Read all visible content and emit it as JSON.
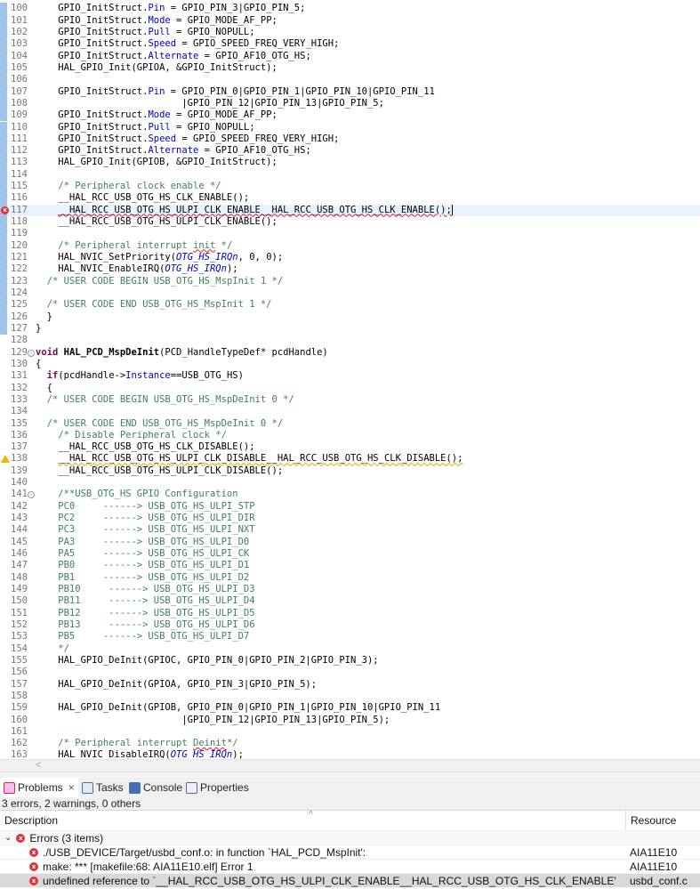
{
  "editor": {
    "lines": [
      {
        "n": "100",
        "chg": 1,
        "s": [
          [
            "t",
            "    GPIO_InitStruct."
          ],
          [
            "f",
            "Pin"
          ],
          [
            "t",
            " = GPIO_PIN_3|GPIO_PIN_5;"
          ]
        ]
      },
      {
        "n": "101",
        "chg": 1,
        "s": [
          [
            "t",
            "    GPIO_InitStruct."
          ],
          [
            "f",
            "Mode"
          ],
          [
            "t",
            " = GPIO_MODE_AF_PP;"
          ]
        ]
      },
      {
        "n": "102",
        "chg": 1,
        "s": [
          [
            "t",
            "    GPIO_InitStruct."
          ],
          [
            "f",
            "Pull"
          ],
          [
            "t",
            " = GPIO_NOPULL;"
          ]
        ]
      },
      {
        "n": "103",
        "chg": 1,
        "s": [
          [
            "t",
            "    GPIO_InitStruct."
          ],
          [
            "f",
            "Speed"
          ],
          [
            "t",
            " = GPIO_SPEED_FREQ_VERY_HIGH;"
          ]
        ]
      },
      {
        "n": "104",
        "chg": 1,
        "s": [
          [
            "t",
            "    GPIO_InitStruct."
          ],
          [
            "f",
            "Alternate"
          ],
          [
            "t",
            " = GPIO_AF10_OTG_HS;"
          ]
        ]
      },
      {
        "n": "105",
        "chg": 1,
        "s": [
          [
            "t",
            "    HAL_GPIO_Init(GPIOA, &GPIO_InitStruct);"
          ]
        ]
      },
      {
        "n": "106",
        "chg": 1,
        "s": []
      },
      {
        "n": "107",
        "chg": 1,
        "s": [
          [
            "t",
            "    GPIO_InitStruct."
          ],
          [
            "f",
            "Pin"
          ],
          [
            "t",
            " = GPIO_PIN_0|GPIO_PIN_1|GPIO_PIN_10|GPIO_PIN_11"
          ]
        ]
      },
      {
        "n": "108",
        "chg": 1,
        "s": [
          [
            "t",
            "                          |GPIO_PIN_12|GPIO_PIN_13|GPIO_PIN_5;"
          ]
        ]
      },
      {
        "n": "109",
        "chg": 1,
        "s": [
          [
            "t",
            "    GPIO_InitStruct."
          ],
          [
            "f",
            "Mode"
          ],
          [
            "t",
            " = GPIO_MODE_AF_PP;"
          ]
        ]
      },
      {
        "n": "110",
        "chg": 1,
        "s": [
          [
            "t",
            "    GPIO_InitStruct."
          ],
          [
            "f",
            "Pull"
          ],
          [
            "t",
            " = GPIO_NOPULL;"
          ]
        ]
      },
      {
        "n": "111",
        "chg": 1,
        "s": [
          [
            "t",
            "    GPIO_InitStruct."
          ],
          [
            "f",
            "Speed"
          ],
          [
            "t",
            " = GPIO_SPEED_FREQ_VERY_HIGH;"
          ]
        ]
      },
      {
        "n": "112",
        "chg": 1,
        "s": [
          [
            "t",
            "    GPIO_InitStruct."
          ],
          [
            "f",
            "Alternate"
          ],
          [
            "t",
            " = GPIO_AF10_OTG_HS;"
          ]
        ]
      },
      {
        "n": "113",
        "chg": 1,
        "s": [
          [
            "t",
            "    HAL_GPIO_Init(GPIOB, &GPIO_InitStruct);"
          ]
        ]
      },
      {
        "n": "114",
        "chg": 1,
        "s": []
      },
      {
        "n": "115",
        "chg": 1,
        "s": [
          [
            "c",
            "    /* Peripheral clock enable */"
          ]
        ]
      },
      {
        "n": "116",
        "chg": 1,
        "s": [
          [
            "t",
            "    __HAL_RCC_USB_OTG_HS_CLK_ENABLE();"
          ]
        ]
      },
      {
        "n": "117",
        "chg": 1,
        "mark": "error",
        "hl": 1,
        "s": [
          [
            "t",
            "    "
          ],
          [
            "err",
            "__HAL_RCC_USB_OTG_HS_ULPI_CLK_ENABLE__HAL_RCC_USB_OTG_HS_CLK_ENABLE();"
          ],
          [
            "caret",
            ""
          ]
        ]
      },
      {
        "n": "118",
        "chg": 1,
        "s": [
          [
            "t",
            "    __HAL_RCC_USB_OTG_HS_ULPI_CLK_ENABLE();"
          ]
        ]
      },
      {
        "n": "119",
        "chg": 1,
        "s": []
      },
      {
        "n": "120",
        "chg": 1,
        "s": [
          [
            "c",
            "    /* Peripheral interrupt "
          ],
          [
            "cs",
            "init"
          ],
          [
            "c",
            " */"
          ]
        ]
      },
      {
        "n": "121",
        "chg": 1,
        "s": [
          [
            "t",
            "    HAL_NVIC_SetPriority("
          ],
          [
            "i",
            "OTG_HS_IRQn"
          ],
          [
            "t",
            ", 0, 0);"
          ]
        ]
      },
      {
        "n": "122",
        "chg": 1,
        "s": [
          [
            "t",
            "    HAL_NVIC_EnableIRQ("
          ],
          [
            "i",
            "OTG_HS_IRQn"
          ],
          [
            "t",
            ");"
          ]
        ]
      },
      {
        "n": "123",
        "chg": 1,
        "s": [
          [
            "c",
            "  /* USER CODE BEGIN USB_OTG_HS_MspInit 1 */"
          ]
        ]
      },
      {
        "n": "124",
        "chg": 1,
        "s": []
      },
      {
        "n": "125",
        "chg": 1,
        "s": [
          [
            "c",
            "  /* USER CODE END USB_OTG_HS_MspInit 1 */"
          ]
        ]
      },
      {
        "n": "126",
        "chg": 1,
        "s": [
          [
            "t",
            "  }"
          ]
        ]
      },
      {
        "n": "127",
        "chg": 1,
        "s": [
          [
            "t",
            "}"
          ]
        ]
      },
      {
        "n": "128",
        "s": []
      },
      {
        "n": "129",
        "fold": 1,
        "s": [
          [
            "k",
            "void"
          ],
          [
            "t",
            " "
          ],
          [
            "b",
            "HAL_PCD_MspDeInit"
          ],
          [
            "t",
            "(PCD_HandleTypeDef* pcdHandle)"
          ]
        ]
      },
      {
        "n": "130",
        "s": [
          [
            "t",
            "{"
          ]
        ]
      },
      {
        "n": "131",
        "s": [
          [
            "t",
            "  "
          ],
          [
            "k",
            "if"
          ],
          [
            "t",
            "(pcdHandle->"
          ],
          [
            "f",
            "Instance"
          ],
          [
            "t",
            "==USB_OTG_HS)"
          ]
        ]
      },
      {
        "n": "132",
        "s": [
          [
            "t",
            "  {"
          ]
        ]
      },
      {
        "n": "133",
        "s": [
          [
            "c",
            "  /* USER CODE BEGIN USB_OTG_HS_MspDeInit 0 */"
          ]
        ]
      },
      {
        "n": "134",
        "s": []
      },
      {
        "n": "135",
        "s": [
          [
            "c",
            "  /* USER CODE END USB_OTG_HS_MspDeInit 0 */"
          ]
        ]
      },
      {
        "n": "136",
        "s": [
          [
            "c",
            "    /* Disable Peripheral clock */"
          ]
        ]
      },
      {
        "n": "137",
        "s": [
          [
            "t",
            "    __HAL_RCC_USB_OTG_HS_CLK_DISABLE();"
          ]
        ]
      },
      {
        "n": "138",
        "mark": "warning",
        "s": [
          [
            "t",
            "    "
          ],
          [
            "warn",
            "__HAL_RCC_USB_OTG_HS_ULPI_CLK_DISABLE__HAL_RCC_USB_OTG_HS_CLK_DISABLE();"
          ]
        ]
      },
      {
        "n": "139",
        "s": [
          [
            "t",
            "    __HAL_RCC_USB_OTG_HS_ULPI_CLK_DISABLE();"
          ]
        ]
      },
      {
        "n": "140",
        "s": []
      },
      {
        "n": "141",
        "fold": 1,
        "s": [
          [
            "c",
            "    /**USB_OTG_HS GPIO Configuration"
          ]
        ]
      },
      {
        "n": "142",
        "s": [
          [
            "c",
            "    PC0     ------> USB_OTG_HS_ULPI_STP"
          ]
        ]
      },
      {
        "n": "143",
        "s": [
          [
            "c",
            "    PC2     ------> USB_OTG_HS_ULPI_DIR"
          ]
        ]
      },
      {
        "n": "144",
        "s": [
          [
            "c",
            "    PC3     ------> USB_OTG_HS_ULPI_NXT"
          ]
        ]
      },
      {
        "n": "145",
        "s": [
          [
            "c",
            "    PA3     ------> USB_OTG_HS_ULPI_D0"
          ]
        ]
      },
      {
        "n": "146",
        "s": [
          [
            "c",
            "    PA5     ------> USB_OTG_HS_ULPI_CK"
          ]
        ]
      },
      {
        "n": "147",
        "s": [
          [
            "c",
            "    PB0     ------> USB_OTG_HS_ULPI_D1"
          ]
        ]
      },
      {
        "n": "148",
        "s": [
          [
            "c",
            "    PB1     ------> USB_OTG_HS_ULPI_D2"
          ]
        ]
      },
      {
        "n": "149",
        "s": [
          [
            "c",
            "    PB10     ------> USB_OTG_HS_ULPI_D3"
          ]
        ]
      },
      {
        "n": "150",
        "s": [
          [
            "c",
            "    PB11     ------> USB_OTG_HS_ULPI_D4"
          ]
        ]
      },
      {
        "n": "151",
        "s": [
          [
            "c",
            "    PB12     ------> USB_OTG_HS_ULPI_D5"
          ]
        ]
      },
      {
        "n": "152",
        "s": [
          [
            "c",
            "    PB13     ------> USB_OTG_HS_ULPI_D6"
          ]
        ]
      },
      {
        "n": "153",
        "s": [
          [
            "c",
            "    PB5     ------> USB_OTG_HS_ULPI_D7"
          ]
        ]
      },
      {
        "n": "154",
        "s": [
          [
            "c",
            "    */"
          ]
        ]
      },
      {
        "n": "155",
        "s": [
          [
            "t",
            "    HAL_GPIO_DeInit(GPIOC, GPIO_PIN_0|GPIO_PIN_2|GPIO_PIN_3);"
          ]
        ]
      },
      {
        "n": "156",
        "s": []
      },
      {
        "n": "157",
        "s": [
          [
            "t",
            "    HAL_GPIO_DeInit(GPIOA, GPIO_PIN_3|GPIO_PIN_5);"
          ]
        ]
      },
      {
        "n": "158",
        "s": []
      },
      {
        "n": "159",
        "s": [
          [
            "t",
            "    HAL_GPIO_DeInit(GPIOB, GPIO_PIN_0|GPIO_PIN_1|GPIO_PIN_10|GPIO_PIN_11"
          ]
        ]
      },
      {
        "n": "160",
        "s": [
          [
            "t",
            "                          |GPIO_PIN_12|GPIO_PIN_13|GPIO_PIN_5);"
          ]
        ]
      },
      {
        "n": "161",
        "s": []
      },
      {
        "n": "162",
        "s": [
          [
            "c",
            "    /* Peripheral interrupt "
          ],
          [
            "cs",
            "Deinit"
          ],
          [
            "c",
            "*/"
          ]
        ]
      },
      {
        "n": "163",
        "s": [
          [
            "t",
            "    HAL_NVIC_DisableIRQ("
          ],
          [
            "i",
            "OTG_HS_IRQn"
          ],
          [
            "t",
            ");"
          ]
        ]
      }
    ]
  },
  "scroll": {
    "left_arrow": "<"
  },
  "tabs": [
    {
      "label": "Problems",
      "icon": "problems-icon",
      "close": "×"
    },
    {
      "label": "Tasks",
      "icon": "tasks-icon"
    },
    {
      "label": "Console",
      "icon": "console-icon"
    },
    {
      "label": "Properties",
      "icon": "properties-icon"
    }
  ],
  "problems": {
    "summary": "3 errors, 2 warnings, 0 others",
    "columns": {
      "description": "Description",
      "resource": "Resource"
    },
    "group": {
      "label": "Errors (3 items)"
    },
    "items": [
      {
        "description": "./USB_DEVICE/Target/usbd_conf.o: in function `HAL_PCD_MspInit':",
        "resource": "AIA11E10"
      },
      {
        "description": "make: *** [makefile:68: AIA11E10.elf] Error 1",
        "resource": "AIA11E10"
      },
      {
        "description": "undefined reference to `__HAL_RCC_USB_OTG_HS_ULPI_CLK_ENABLE__HAL_RCC_USB_OTG_HS_CLK_ENABLE'",
        "resource": "usbd_conf.c"
      }
    ]
  }
}
